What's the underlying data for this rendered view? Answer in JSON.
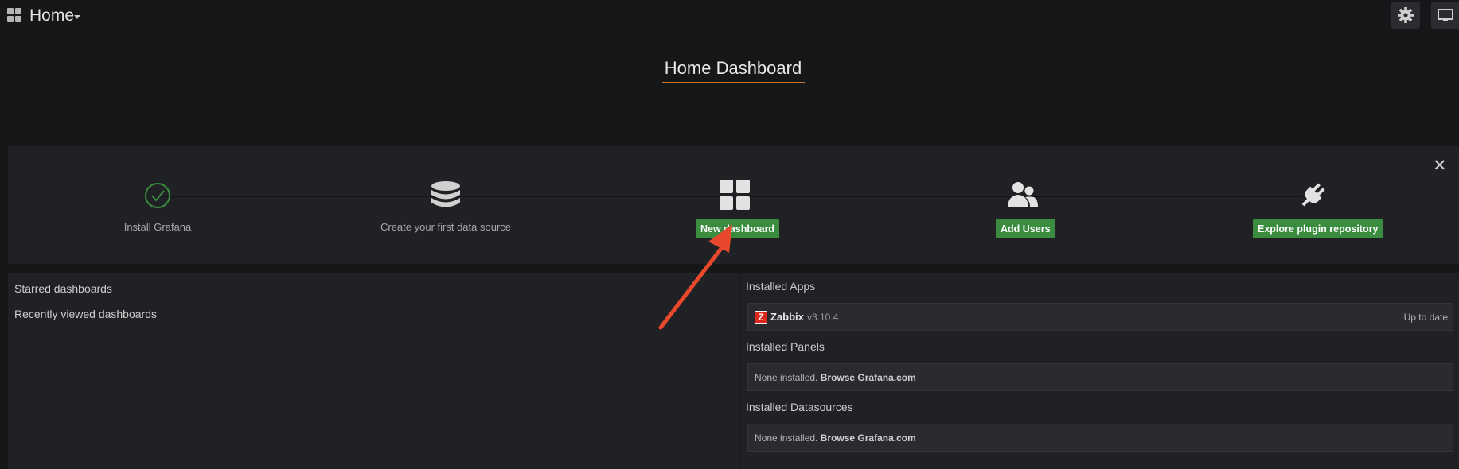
{
  "nav": {
    "title": "Home",
    "icons": {
      "logo": "grid-icon",
      "caret": "caret-down-icon",
      "settings": "gear-icon",
      "tv": "tv-icon"
    }
  },
  "dashboard": {
    "title": "Home Dashboard"
  },
  "getting_started": {
    "close": "✕",
    "steps": [
      {
        "label": "Install Grafana",
        "done": true,
        "icon": "check-circle-icon"
      },
      {
        "label": "Create your first data source",
        "done": true,
        "icon": "database-icon"
      },
      {
        "label": "New dashboard",
        "done": false,
        "icon": "dashboard-grid-icon"
      },
      {
        "label": "Add Users",
        "done": false,
        "icon": "users-icon"
      },
      {
        "label": "Explore plugin repository",
        "done": false,
        "icon": "plug-icon"
      }
    ]
  },
  "left_panel": {
    "starred": "Starred dashboards",
    "recent": "Recently viewed dashboards"
  },
  "right_panel": {
    "apps_heading": "Installed Apps",
    "app": {
      "logo": "Z",
      "name": "Zabbix",
      "version": "v3.10.4",
      "status": "Up to date"
    },
    "panels_heading": "Installed Panels",
    "datasources_heading": "Installed Datasources",
    "none_text": "None installed.",
    "browse_link": "Browse Grafana.com"
  },
  "colors": {
    "background": "#161719",
    "panel": "#202124",
    "accent_green": "#3a8c3f",
    "underline_orange": "#c9722b",
    "annotation_arrow": "#e8492c"
  }
}
